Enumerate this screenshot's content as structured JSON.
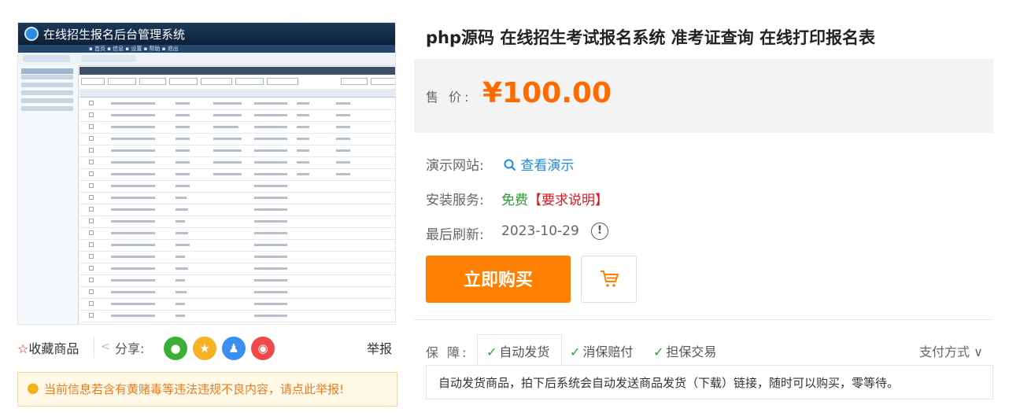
{
  "preview": {
    "title": "在线招生报名后台管理系统",
    "menu_text": "▪ 首页  ▪ 信息  ▪ 设置  ▪ 帮助  ▪ 退出"
  },
  "left_bar": {
    "favorite_label": "收藏商品",
    "share_label": "分享:",
    "report_label": "举报",
    "notice_text": "当前信息若含有黄赌毒等违法违规不良内容，请点此举报!",
    "share_icons": [
      "wechat-icon",
      "qzone-icon",
      "qq-icon",
      "weibo-icon"
    ]
  },
  "product": {
    "title": "php源码 在线招生考试报名系统 准考证查询 在线打印报名表",
    "price_label": "售 价:",
    "price": "¥100.00",
    "demo_label": "演示网站:",
    "demo_link": "查看演示",
    "install_label": "安装服务:",
    "install_free": "免费",
    "install_requirement": "【要求说明】",
    "refresh_label": "最后刷新:",
    "refresh_date": "2023-10-29",
    "buy_label": "立即购买",
    "guarantee_label": "保 障:",
    "guarantees": [
      "自动发货",
      "消保赔付",
      "担保交易"
    ],
    "payment_label": "支付方式",
    "description": "自动发货商品，拍下后系统会自动发送商品发货（下载）链接，随时可以购买，零等待。"
  },
  "colors": {
    "accent": "#ff7f00",
    "price": "#ff6a00",
    "link": "#1b8ce8",
    "free": "#2d9a2d",
    "warning": "#e0141e"
  }
}
